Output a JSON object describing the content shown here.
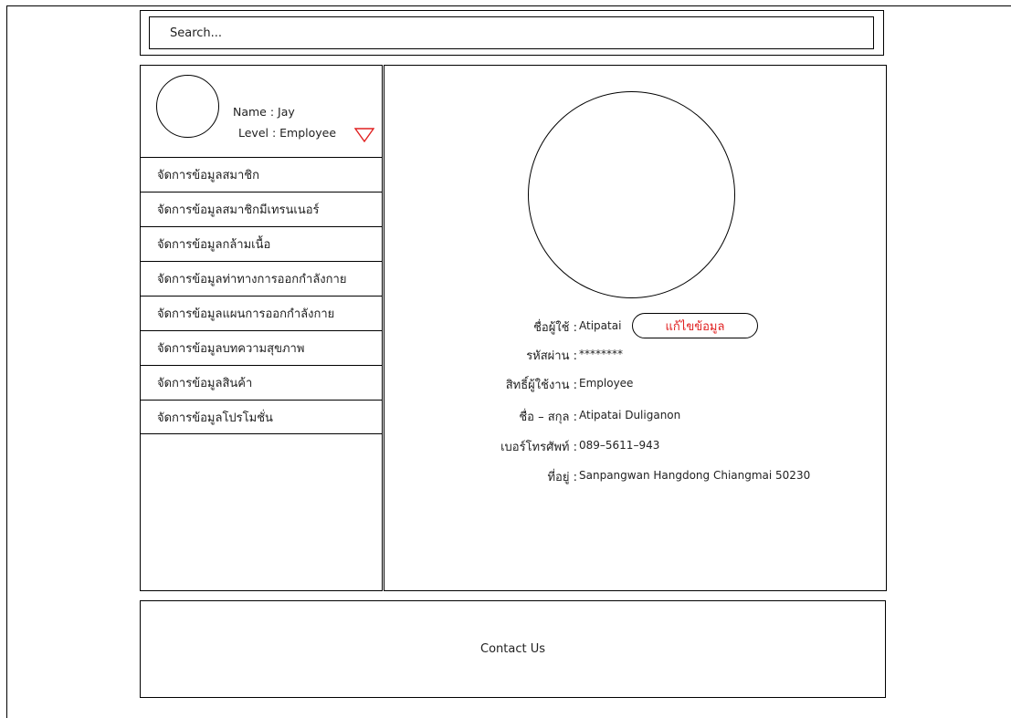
{
  "search": {
    "placeholder": "Search..."
  },
  "profile": {
    "name_text": "Name : Jay",
    "level_text": "Level : Employee",
    "dropdown_icon": "triangle-down-icon",
    "dropdown_color": "#e02020"
  },
  "sidebar": {
    "items": [
      {
        "label": "จัดการข้อมูลสมาชิก"
      },
      {
        "label": "จัดการข้อมูลสมาชิกมีเทรนเนอร์"
      },
      {
        "label": "จัดการข้อมูลกล้ามเนื้อ"
      },
      {
        "label": "จัดการข้อมูลท่าทางการออกกำลังกาย"
      },
      {
        "label": "จัดการข้อมูลแผนการออกกำลังกาย"
      },
      {
        "label": "จัดการข้อมูลบทความสุขภาพ"
      },
      {
        "label": "จัดการข้อมูลสินค้า"
      },
      {
        "label": "จัดการข้อมูลโปรโมชั่น"
      }
    ]
  },
  "details": {
    "username_label": "ชื่อผู้ใช้ :",
    "username_value": "Atipatai",
    "edit_button_label": "แก้ไขข้อมูล",
    "edit_button_color": "#e02020",
    "password_label": "รหัสผ่าน :",
    "password_value": "********",
    "role_label": "สิทธิ์ผู้ใช้งาน :",
    "role_value": "Employee",
    "fullname_label": "ชื่อ – สกุล :",
    "fullname_value": "Atipatai Duliganon",
    "phone_label": "เบอร์โทรศัพท์ :",
    "phone_value": "089–5611–943",
    "address_label": "ที่อยู่ :",
    "address_value": "Sanpangwan Hangdong Chiangmai 50230"
  },
  "footer": {
    "contact_label": "Contact Us"
  }
}
